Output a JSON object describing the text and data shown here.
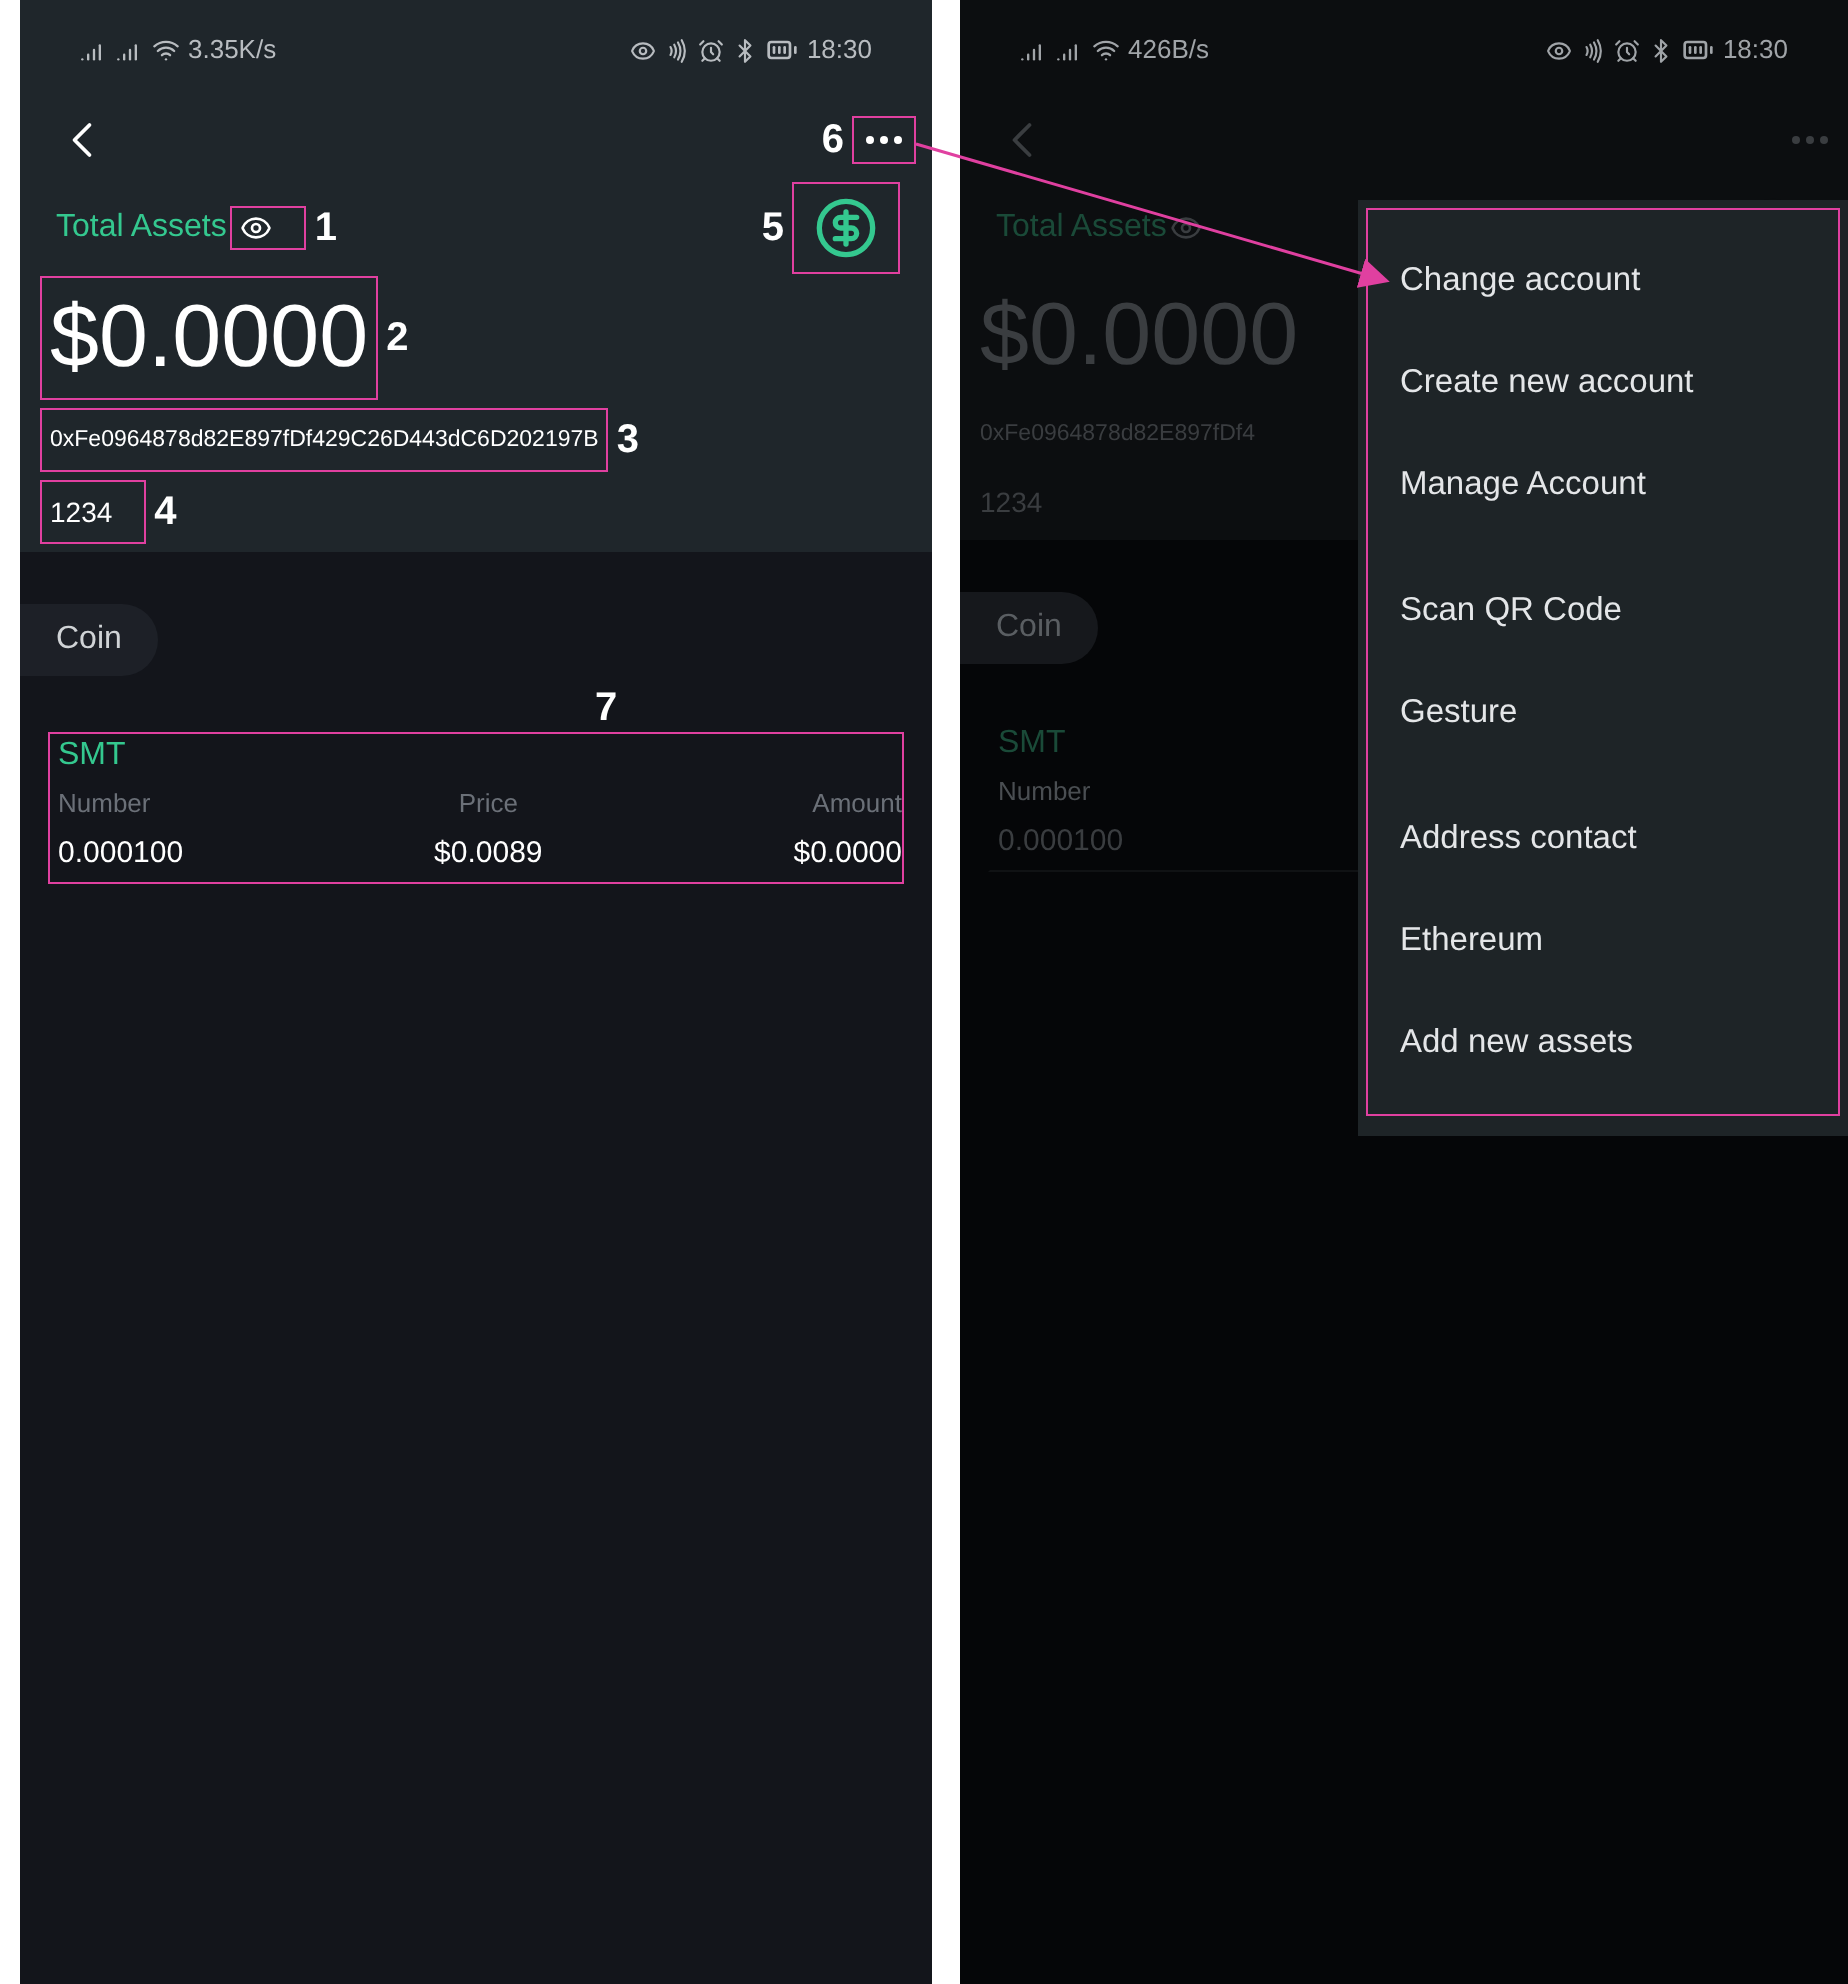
{
  "left_screen": {
    "dimmed": false,
    "status_bar": {
      "speed": "3.35K/s",
      "time": "18:30"
    },
    "total_assets_label": "Total Assets",
    "balance": "$0.0000",
    "address": "0xFe0964878d82E897fDf429C26D443dC6D202197B",
    "account_name": "1234",
    "tabs": [
      {
        "label": "Coin",
        "selected": true
      }
    ],
    "asset": {
      "symbol": "SMT",
      "columns": [
        {
          "label": "Number",
          "value": "0.000100"
        },
        {
          "label": "Price",
          "value": "$0.0089"
        },
        {
          "label": "Amount",
          "value": "$0.0000"
        }
      ]
    },
    "callouts": {
      "eye": "1",
      "balance": "2",
      "address": "3",
      "account_name": "4",
      "coin_button": "5",
      "more_button": "6",
      "asset_card": "7"
    }
  },
  "right_screen": {
    "dimmed": true,
    "status_bar": {
      "speed": "426B/s",
      "time": "18:30"
    },
    "total_assets_label": "Total Assets",
    "balance": "$0.0000",
    "address": "0xFe0964878d82E897fDf4",
    "account_name": "1234",
    "tabs": [
      {
        "label": "Coin",
        "selected": true
      }
    ],
    "asset": {
      "symbol": "SMT",
      "columns": [
        {
          "label": "Number",
          "value": "0.000100"
        }
      ]
    },
    "menu": {
      "groups": [
        {
          "items": [
            "Change account",
            "Create new account",
            "Manage Account"
          ]
        },
        {
          "items": [
            "Scan QR Code",
            "Gesture"
          ]
        },
        {
          "items": [
            "Address contact",
            "Ethereum",
            "Add new assets"
          ]
        }
      ]
    }
  }
}
